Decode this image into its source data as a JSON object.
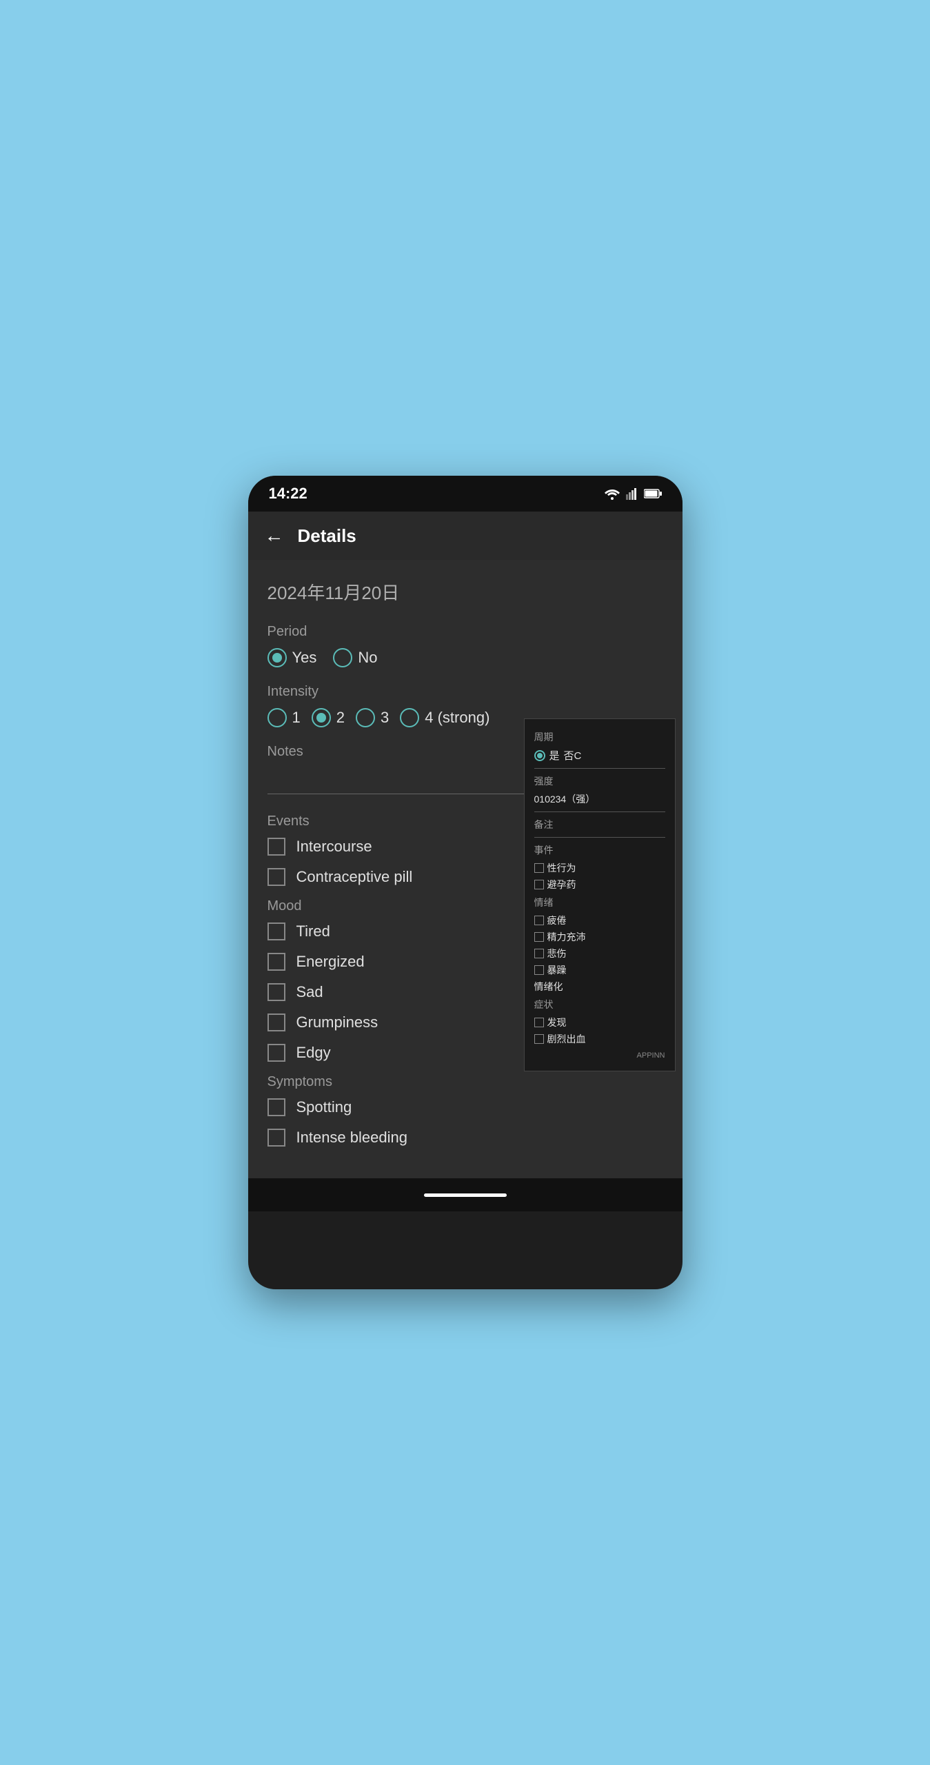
{
  "status_bar": {
    "time": "14:22"
  },
  "app_bar": {
    "title": "Details",
    "back_label": "←"
  },
  "date": "2024年11月20日",
  "period_section": {
    "label": "Period",
    "options": [
      {
        "value": "yes",
        "label": "Yes",
        "selected": true
      },
      {
        "value": "no",
        "label": "No",
        "selected": false
      }
    ]
  },
  "intensity_section": {
    "label": "Intensity",
    "options": [
      {
        "value": "1",
        "label": "1",
        "selected": false
      },
      {
        "value": "2",
        "label": "2",
        "selected": true
      },
      {
        "value": "3",
        "label": "3",
        "selected": false
      },
      {
        "value": "4",
        "label": "4 (strong)",
        "selected": false
      }
    ]
  },
  "notes_section": {
    "label": "Notes",
    "placeholder": ""
  },
  "events_section": {
    "label": "Events",
    "items": [
      {
        "label": "Intercourse",
        "checked": false
      },
      {
        "label": "Contraceptive pill",
        "checked": false
      }
    ]
  },
  "mood_section": {
    "label": "Mood",
    "items": [
      {
        "label": "Tired",
        "checked": false
      },
      {
        "label": "Energized",
        "checked": false
      },
      {
        "label": "Sad",
        "checked": false
      },
      {
        "label": "Grumpiness",
        "checked": false
      },
      {
        "label": "Edgy",
        "checked": false
      }
    ]
  },
  "symptoms_section": {
    "label": "Symptoms",
    "items": [
      {
        "label": "Spotting",
        "checked": false
      },
      {
        "label": "Intense bleeding",
        "checked": false
      }
    ]
  },
  "popup": {
    "period_label": "周期",
    "period_yes": "是",
    "period_no": "否C",
    "intensity_label": "强度",
    "intensity_values": "010234（强）",
    "notes_label": "备注",
    "events_label": "事件",
    "event1": "性行为",
    "event2": "避孕药",
    "mood_label": "情绪",
    "mood1": "疲倦",
    "mood2": "精力充沛",
    "mood3": "悲伤",
    "mood4": "暴躁",
    "mood5": "情绪化",
    "symptoms_label": "症状",
    "symptom1": "发现",
    "symptom2": "剧烈出血",
    "appinn": "APPINN"
  },
  "colors": {
    "teal": "#5bbcb8",
    "background": "#2d2d2d",
    "label": "#9a9a9a",
    "text": "#e0e0e0"
  }
}
